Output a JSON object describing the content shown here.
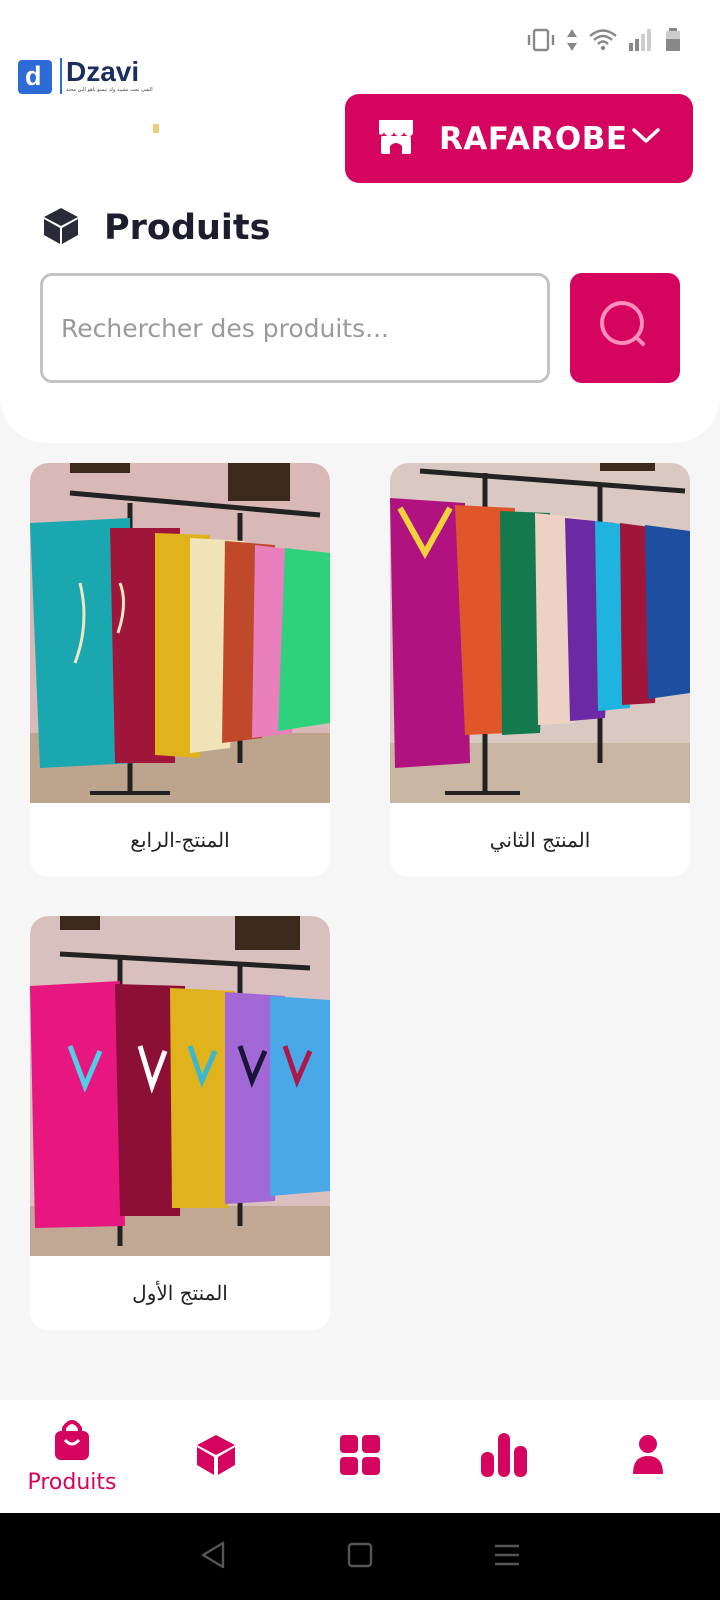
{
  "brand": {
    "name": "Dzavi",
    "letter": "d",
    "tagline": "الشي نحت نشيبه وك تيسو باهو الين محنة"
  },
  "store_selector": {
    "name": "RAFAROBE"
  },
  "page": {
    "title": "Produits"
  },
  "search": {
    "placeholder": "Rechercher des produits..."
  },
  "products": [
    {
      "name": "المنتج-الرابع"
    },
    {
      "name": "المنتج الثاني"
    },
    {
      "name": "المنتج الأول"
    }
  ],
  "bottom_nav": [
    {
      "label": "Produits",
      "icon": "shopping-bag-icon",
      "active": true
    },
    {
      "label": "",
      "icon": "box-icon",
      "active": false
    },
    {
      "label": "",
      "icon": "grid-icon",
      "active": false
    },
    {
      "label": "",
      "icon": "bar-chart-icon",
      "active": false
    },
    {
      "label": "",
      "icon": "user-icon",
      "active": false
    }
  ],
  "colors": {
    "accent": "#d4045f",
    "brand_blue": "#2f6bd6",
    "background": "#f6f6f6"
  }
}
